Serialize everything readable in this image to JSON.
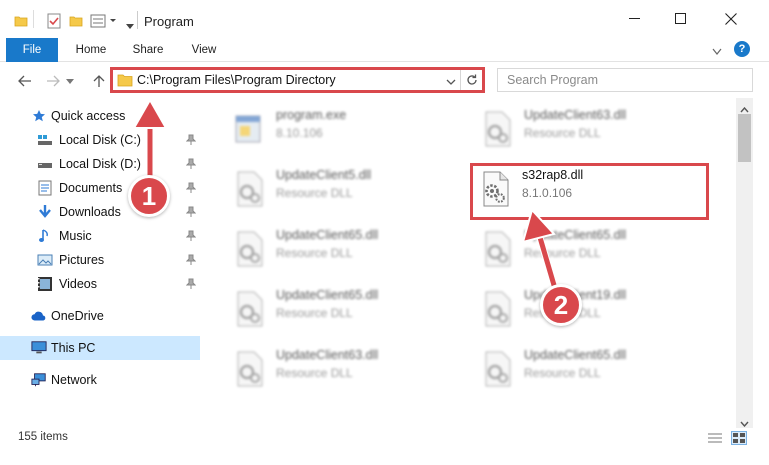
{
  "window": {
    "title": "Program",
    "minimize_icon": "minimize-icon",
    "maximize_icon": "maximize-icon",
    "close_icon": "close-icon"
  },
  "ribbon": {
    "tabs": [
      {
        "label": "File"
      },
      {
        "label": "Home"
      },
      {
        "label": "Share"
      },
      {
        "label": "View"
      }
    ]
  },
  "address": {
    "path": "C:\\Program Files\\Program Directory",
    "search_placeholder": "Search Program"
  },
  "sidebar": {
    "items": [
      {
        "label": "Quick access",
        "icon": "star-icon"
      },
      {
        "label": "Local Disk (C:)",
        "icon": "drive-icon"
      },
      {
        "label": "Local Disk (D:)",
        "icon": "drive-icon"
      },
      {
        "label": "Documents",
        "icon": "documents-icon"
      },
      {
        "label": "Downloads",
        "icon": "download-icon"
      },
      {
        "label": "Music",
        "icon": "music-icon"
      },
      {
        "label": "Pictures",
        "icon": "pictures-icon"
      },
      {
        "label": "Videos",
        "icon": "videos-icon"
      },
      {
        "label": "OneDrive",
        "icon": "cloud-icon"
      },
      {
        "label": "This PC",
        "icon": "computer-icon"
      },
      {
        "label": "Network",
        "icon": "network-icon"
      }
    ]
  },
  "files": [
    {
      "name": "program.exe",
      "sub": "8.10.106"
    },
    {
      "name": "UpdateClient63.dll",
      "sub": "Resource DLL"
    },
    {
      "name": "UpdateClient5.dll",
      "sub": "Resource DLL"
    },
    {
      "name": "s32rap8.dll",
      "sub": "8.1.0.106"
    },
    {
      "name": "UpdateClient65.dll",
      "sub": "Resource DLL"
    },
    {
      "name": "UpdateClient65.dll",
      "sub": "Resource DLL"
    },
    {
      "name": "UpdateClient65.dll",
      "sub": "Resource DLL"
    },
    {
      "name": "UpdateClient19.dll",
      "sub": "Resource DLL"
    },
    {
      "name": "UpdateClient63.dll",
      "sub": "Resource DLL"
    },
    {
      "name": "UpdateClient65.dll",
      "sub": "Resource DLL"
    }
  ],
  "status": {
    "item_count": "155 items"
  },
  "annotations": {
    "step1": "1",
    "step2": "2",
    "color": "#d9484c"
  },
  "colors": {
    "accent": "#1979ca",
    "selected": "#cce8ff",
    "highlight": "#d9484c"
  }
}
